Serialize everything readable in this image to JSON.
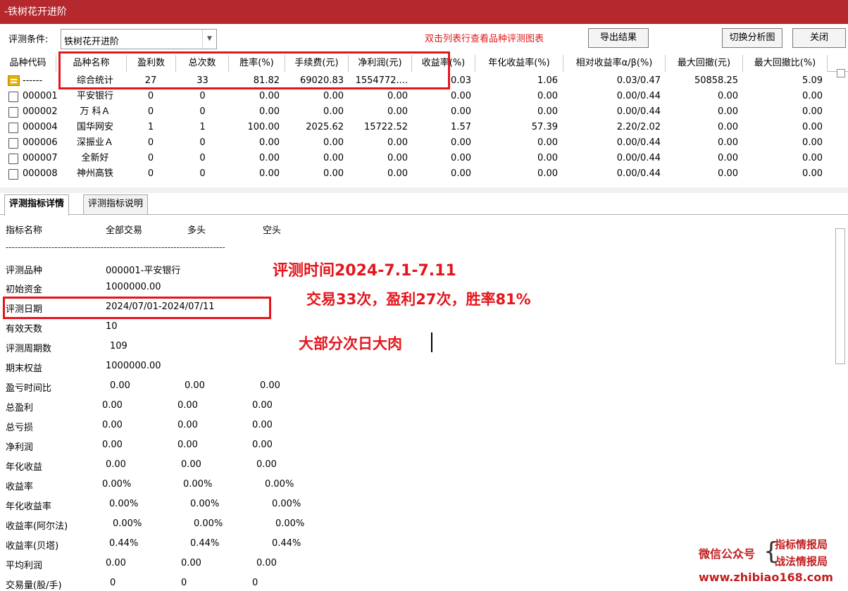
{
  "window": {
    "title": "-铁树花开进阶"
  },
  "toolbar": {
    "condition_label": "评测条件:",
    "condition_value": "铁树花开进阶",
    "hint": "双击列表行查看品种评测图表",
    "export_label": "导出结果",
    "switch_label": "切换分析图",
    "close_label": "关闭"
  },
  "grid": {
    "headers": [
      "品种代码",
      "品种名称",
      "盈利数",
      "总次数",
      "胜率(%)",
      "手续费(元)",
      "净利润(元)",
      "收益率(%)",
      "年化收益率(%)",
      "相对收益率α/β(%)",
      "最大回撤(元)",
      "最大回撤比(%)"
    ],
    "rows": [
      [
        "------",
        "综合统计",
        "27",
        "33",
        "81.82",
        "69020.83",
        "1554772....",
        "0.03",
        "1.06",
        "0.03/0.47",
        "50858.25",
        "5.09"
      ],
      [
        "000001",
        "平安银行",
        "0",
        "0",
        "0.00",
        "0.00",
        "0.00",
        "0.00",
        "0.00",
        "0.00/0.44",
        "0.00",
        "0.00"
      ],
      [
        "000002",
        "万 科Ａ",
        "0",
        "0",
        "0.00",
        "0.00",
        "0.00",
        "0.00",
        "0.00",
        "0.00/0.44",
        "0.00",
        "0.00"
      ],
      [
        "000004",
        "国华网安",
        "1",
        "1",
        "100.00",
        "2025.62",
        "15722.52",
        "1.57",
        "57.39",
        "2.20/2.02",
        "0.00",
        "0.00"
      ],
      [
        "000006",
        "深振业Ａ",
        "0",
        "0",
        "0.00",
        "0.00",
        "0.00",
        "0.00",
        "0.00",
        "0.00/0.44",
        "0.00",
        "0.00"
      ],
      [
        "000007",
        "全新好",
        "0",
        "0",
        "0.00",
        "0.00",
        "0.00",
        "0.00",
        "0.00",
        "0.00/0.44",
        "0.00",
        "0.00"
      ],
      [
        "000008",
        "神州高铁",
        "0",
        "0",
        "0.00",
        "0.00",
        "0.00",
        "0.00",
        "0.00",
        "0.00/0.44",
        "0.00",
        "0.00"
      ]
    ]
  },
  "tabs": [
    "评测指标详情",
    "评测指标说明"
  ],
  "detail": {
    "header": [
      "指标名称",
      "全部交易",
      "多头",
      "空头"
    ],
    "separator": "------------------------------------------------------------------------",
    "info": [
      [
        "评测品种",
        "000001-平安银行"
      ],
      [
        "初始资金",
        "1000000.00"
      ],
      [
        "评测日期",
        "2024/07/01-2024/07/11"
      ],
      [
        "有效天数",
        "10"
      ],
      [
        "评测周期数",
        "109"
      ],
      [
        "期末权益",
        "1000000.00"
      ]
    ],
    "stats": [
      [
        "盈亏时间比",
        "0.00",
        "0.00",
        "0.00"
      ],
      [
        "总盈利",
        "0.00",
        "0.00",
        "0.00"
      ],
      [
        "总亏损",
        "0.00",
        "0.00",
        "0.00"
      ],
      [
        "净利润",
        "0.00",
        "0.00",
        "0.00"
      ],
      [
        "年化收益",
        "0.00",
        "0.00",
        "0.00"
      ],
      [
        "收益率",
        "0.00%",
        "0.00%",
        "0.00%"
      ],
      [
        "年化收益率",
        "0.00%",
        "0.00%",
        "0.00%"
      ],
      [
        "收益率(阿尔法)",
        "0.00%",
        "0.00%",
        "0.00%"
      ],
      [
        "收益率(贝塔)",
        "0.44%",
        "0.44%",
        "0.44%"
      ],
      [
        "平均利润",
        "0.00",
        "0.00",
        "0.00"
      ],
      [
        "交易量(股/手)",
        "0",
        "0",
        "0"
      ]
    ]
  },
  "annotations": {
    "line1": "评测时间2024-7.1-7.11",
    "line2": "交易33次，盈利27次，胜率81%",
    "line3": "大部分次日大肉"
  },
  "watermark": {
    "account_label": "微信公众号",
    "name1": "指标情报局",
    "name2": "战法情报局",
    "url": "www.zhibiao168.com"
  },
  "colors": {
    "title_bar": "#b5282e",
    "annotation_red": "#e4161c",
    "summary_icon": "#e8b20a"
  }
}
